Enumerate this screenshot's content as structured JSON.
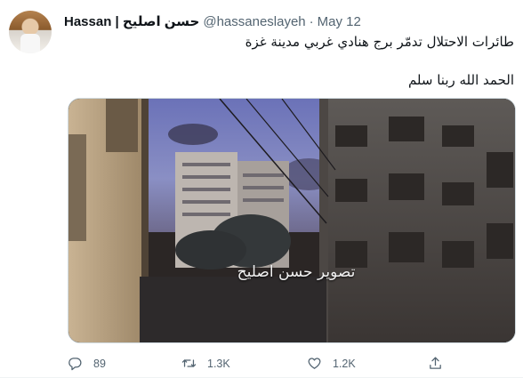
{
  "tweet": {
    "display_name": "Hassan | حسن اصليح",
    "handle": "@hassaneslayeh",
    "separator": "·",
    "date": "May 12",
    "text_line1": "طائرات الاحتلال تدمّر برج هنادي غربي مدينة غزة",
    "text_line2": "الحمد الله ربنا سلم",
    "media": {
      "watermark": "تصوير حسن اصليح"
    },
    "actions": {
      "reply_icon": "reply-icon",
      "reply_count": "89",
      "retweet_icon": "retweet-icon",
      "retweet_count": "1.3K",
      "like_icon": "heart-icon",
      "like_count": "1.2K",
      "share_icon": "share-icon"
    }
  },
  "colors": {
    "text_primary": "#0f1419",
    "text_secondary": "#536471",
    "border": "#cfd9de"
  }
}
